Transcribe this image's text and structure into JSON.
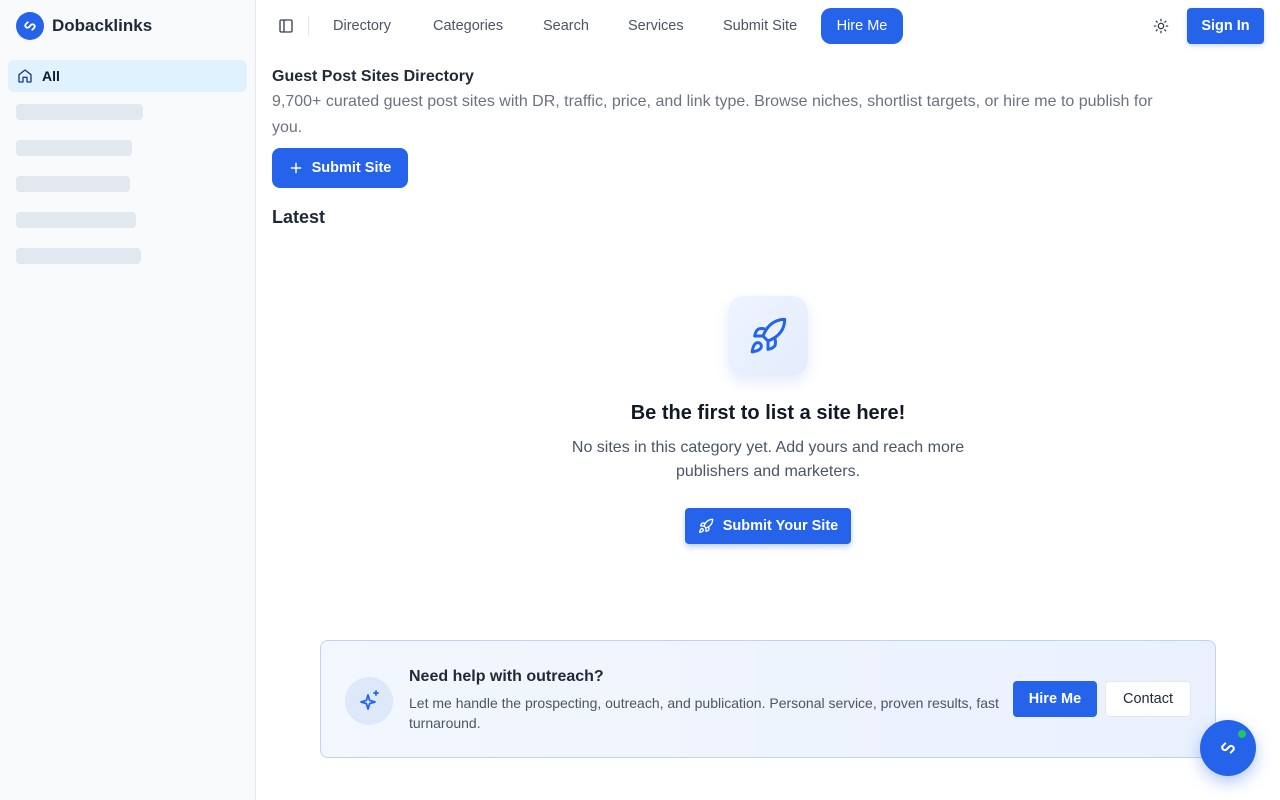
{
  "app": {
    "brand_name": "Dobacklinks",
    "accent_color": "#2563eb",
    "brand_icon": "brand-link-icon"
  },
  "sidebar": {
    "active_item": {
      "label": "All",
      "icon": "home-icon"
    },
    "loading_placeholders": 5
  },
  "topnav": {
    "toggle_icon": "sidebar-toggle-icon",
    "links": [
      "Directory",
      "Categories",
      "Search",
      "Services",
      "Submit Site"
    ],
    "hire_label": "Hire Me",
    "theme_icon": "sun-icon",
    "signin_label": "Sign In"
  },
  "header": {
    "title": "Guest Post Sites Directory",
    "description": "9,700+ curated guest post sites with DR, traffic, price, and link type. Browse niches, shortlist targets, or hire me to publish for you.",
    "submit_label": "Submit Site"
  },
  "section": {
    "title": "Latest"
  },
  "empty_state": {
    "icon": "rocket-icon",
    "title": "Be the first to list a site here!",
    "description": "No sites in this category yet. Add yours and reach more publishers and marketers.",
    "button_label": "Submit Your Site"
  },
  "cta": {
    "icon": "sparkles-icon",
    "title": "Need help with outreach?",
    "description": "Let me handle the prospecting, outreach, and publication. Personal service, proven results, fast turnaround.",
    "hire_label": "Hire Me",
    "contact_label": "Contact"
  },
  "chat": {
    "icon": "brand-link-icon",
    "status_color": "#22c55e"
  }
}
